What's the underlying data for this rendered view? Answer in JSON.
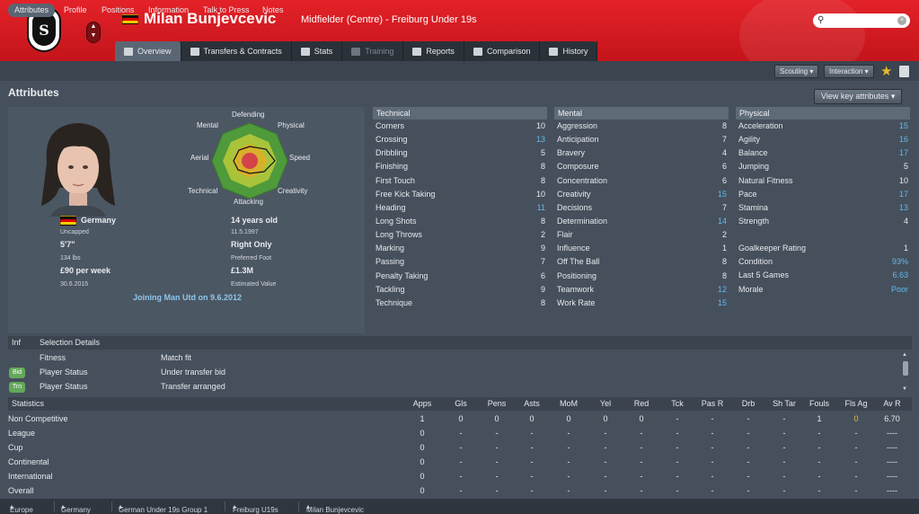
{
  "header": {
    "player_name": "Milan Bunjevcevic",
    "subtitle": "Midfielder (Centre) - Freiburg Under 19s",
    "club_logo_letter": "S",
    "search": {
      "value": "",
      "placeholder": ""
    }
  },
  "tabs": [
    "Overview",
    "Transfers & Contracts",
    "Stats",
    "Training",
    "Reports",
    "Comparison",
    "History"
  ],
  "subnav": [
    "Attributes",
    "Profile",
    "Positions",
    "Information",
    "Talk to Press",
    "Notes"
  ],
  "buttons": {
    "scouting": "Scouting",
    "interaction": "Interaction",
    "view_key": "View key attributes"
  },
  "page_title": "Attributes",
  "profile": {
    "nationality": "Germany",
    "caps": "Uncapped",
    "height": "5'7\"",
    "weight": "134 lbs",
    "wage": "£90 per week",
    "contract_end": "30.6.2015",
    "age": "14 years old",
    "dob": "11.5.1997",
    "foot": "Right Only",
    "foot_label": "Preferred Foot",
    "value": "£1.3M",
    "value_label": "Estimated Value",
    "joining": "Joining Man Utd on 9.6.2012"
  },
  "spider": {
    "labels": {
      "defending": "Defending",
      "physical": "Physical",
      "speed": "Speed",
      "creativity": "Creativity",
      "attacking": "Attacking",
      "technical": "Technical",
      "aerial": "Aerial",
      "mental": "Mental"
    },
    "colors": {
      "outer": "#4f9a3a",
      "middle": "#c9c933",
      "inner": "#d8892c",
      "core": "#d4434a"
    }
  },
  "technical": {
    "heading": "Technical",
    "rows": [
      {
        "name": "Corners",
        "value": "10"
      },
      {
        "name": "Crossing",
        "value": "13"
      },
      {
        "name": "Dribbling",
        "value": "5"
      },
      {
        "name": "Finishing",
        "value": "8"
      },
      {
        "name": "First Touch",
        "value": "8"
      },
      {
        "name": "Free Kick Taking",
        "value": "10"
      },
      {
        "name": "Heading",
        "value": "11"
      },
      {
        "name": "Long Shots",
        "value": "8"
      },
      {
        "name": "Long Throws",
        "value": "2"
      },
      {
        "name": "Marking",
        "value": "9"
      },
      {
        "name": "Passing",
        "value": "7"
      },
      {
        "name": "Penalty Taking",
        "value": "6"
      },
      {
        "name": "Tackling",
        "value": "9"
      },
      {
        "name": "Technique",
        "value": "8"
      }
    ]
  },
  "mental": {
    "heading": "Mental",
    "rows": [
      {
        "name": "Aggression",
        "value": "8"
      },
      {
        "name": "Anticipation",
        "value": "7"
      },
      {
        "name": "Bravery",
        "value": "4"
      },
      {
        "name": "Composure",
        "value": "6"
      },
      {
        "name": "Concentration",
        "value": "6"
      },
      {
        "name": "Creativity",
        "value": "15"
      },
      {
        "name": "Decisions",
        "value": "7"
      },
      {
        "name": "Determination",
        "value": "14"
      },
      {
        "name": "Flair",
        "value": "2"
      },
      {
        "name": "Influence",
        "value": "1"
      },
      {
        "name": "Off The Ball",
        "value": "8"
      },
      {
        "name": "Positioning",
        "value": "8"
      },
      {
        "name": "Teamwork",
        "value": "12"
      },
      {
        "name": "Work Rate",
        "value": "15"
      }
    ]
  },
  "physical": {
    "heading": "Physical",
    "rows": [
      {
        "name": "Acceleration",
        "value": "15"
      },
      {
        "name": "Agility",
        "value": "16"
      },
      {
        "name": "Balance",
        "value": "17"
      },
      {
        "name": "Jumping",
        "value": "5"
      },
      {
        "name": "Natural Fitness",
        "value": "10"
      },
      {
        "name": "Pace",
        "value": "17"
      },
      {
        "name": "Stamina",
        "value": "13"
      },
      {
        "name": "Strength",
        "value": "4"
      }
    ],
    "extra": [
      {
        "name": "Goalkeeper Rating",
        "value": "1"
      },
      {
        "name": "Condition",
        "value": "93%"
      },
      {
        "name": "Last 5 Games",
        "value": "6.63"
      },
      {
        "name": "Morale",
        "value": "Poor"
      }
    ]
  },
  "selection": {
    "headers": [
      "Inf",
      "Selection Details"
    ],
    "rows": [
      {
        "badge": "",
        "label": "Fitness",
        "value": "Match fit"
      },
      {
        "badge": "Bid",
        "label": "Player Status",
        "value": "Under transfer bid"
      },
      {
        "badge": "Trn",
        "label": "Player Status",
        "value": "Transfer arranged"
      }
    ]
  },
  "stats": {
    "label": "Statistics",
    "columns": [
      "Apps",
      "Gls",
      "Pens",
      "Asts",
      "MoM",
      "Yel",
      "Red",
      "Tck",
      "Pas R",
      "Drb",
      "Sh Tar",
      "Fouls",
      "Fls Ag",
      "Av R"
    ],
    "rows": [
      {
        "name": "Non Competitive",
        "cells": [
          "1",
          "0",
          "0",
          "0",
          "0",
          "0",
          "0",
          "-",
          "-",
          "-",
          "-",
          "1",
          "0",
          "6.70"
        ]
      },
      {
        "name": "League",
        "cells": [
          "0",
          "-",
          "-",
          "-",
          "-",
          "-",
          "-",
          "-",
          "-",
          "-",
          "-",
          "-",
          "-",
          "----"
        ]
      },
      {
        "name": "Cup",
        "cells": [
          "0",
          "-",
          "-",
          "-",
          "-",
          "-",
          "-",
          "-",
          "-",
          "-",
          "-",
          "-",
          "-",
          "----"
        ]
      },
      {
        "name": "Continental",
        "cells": [
          "0",
          "-",
          "-",
          "-",
          "-",
          "-",
          "-",
          "-",
          "-",
          "-",
          "-",
          "-",
          "-",
          "----"
        ]
      },
      {
        "name": "International",
        "cells": [
          "0",
          "-",
          "-",
          "-",
          "-",
          "-",
          "-",
          "-",
          "-",
          "-",
          "-",
          "-",
          "-",
          "----"
        ]
      },
      {
        "name": "Overall",
        "cells": [
          "0",
          "-",
          "-",
          "-",
          "-",
          "-",
          "-",
          "-",
          "-",
          "-",
          "-",
          "-",
          "-",
          "----"
        ]
      }
    ]
  },
  "footer": [
    "Europe",
    "Germany",
    "German Under 19s Group 1",
    "Freiburg U19s",
    "Milan Bunjevcevic"
  ]
}
